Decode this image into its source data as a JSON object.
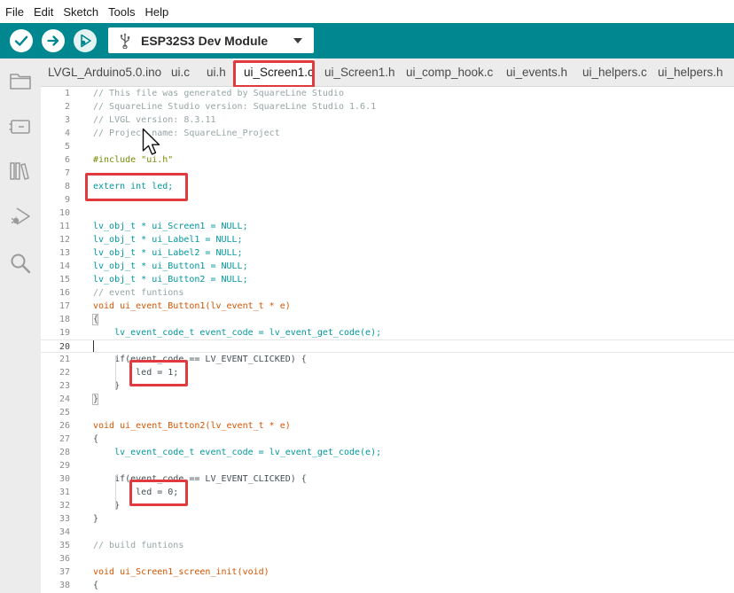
{
  "menu": [
    "File",
    "Edit",
    "Sketch",
    "Tools",
    "Help"
  ],
  "toolbar": {
    "verify_icon": "check-icon",
    "upload_icon": "arrow-right-icon",
    "debug_icon": "debug-play-icon",
    "board_name": "ESP32S3 Dev Module",
    "board_icon": "usb-icon"
  },
  "sidebar": [
    "folder-icon",
    "board-manager-icon",
    "library-icon",
    "debug-icon",
    "search-icon"
  ],
  "tabs": [
    "LVGL_Arduino5.0.ino",
    "ui.c",
    "ui.h",
    "ui_Screen1.c",
    "ui_Screen1.h",
    "ui_comp_hook.c",
    "ui_events.h",
    "ui_helpers.c",
    "ui_helpers.h"
  ],
  "active_tab": "ui_Screen1.c",
  "colors": {
    "toolbar": "#00878f",
    "highlight": "#e0393e"
  },
  "code_lines": [
    "// This file was generated by SquareLine Studio",
    "// SquareLine Studio version: SquareLine Studio 1.6.1",
    "// LVGL version: 8.3.11",
    "// Project name: SquareLine_Project",
    "",
    "#include \"ui.h\"",
    "",
    "extern int led;",
    "",
    "",
    "lv_obj_t * ui_Screen1 = NULL;",
    "lv_obj_t * ui_Label1 = NULL;",
    "lv_obj_t * ui_Label2 = NULL;",
    "lv_obj_t * ui_Button1 = NULL;",
    "lv_obj_t * ui_Button2 = NULL;",
    "// event funtions",
    "void ui_event_Button1(lv_event_t * e)",
    "{",
    "    lv_event_code_t event_code = lv_event_get_code(e);",
    "",
    "    if(event_code == LV_EVENT_CLICKED) {",
    "        led = 1;",
    "    }",
    "}",
    "",
    "void ui_event_Button2(lv_event_t * e)",
    "{",
    "    lv_event_code_t event_code = lv_event_get_code(e);",
    "",
    "    if(event_code == LV_EVENT_CLICKED) {",
    "        led = 0;",
    "    }",
    "}",
    "",
    "// build funtions",
    "",
    "void ui_Screen1_screen_init(void)",
    "{"
  ]
}
